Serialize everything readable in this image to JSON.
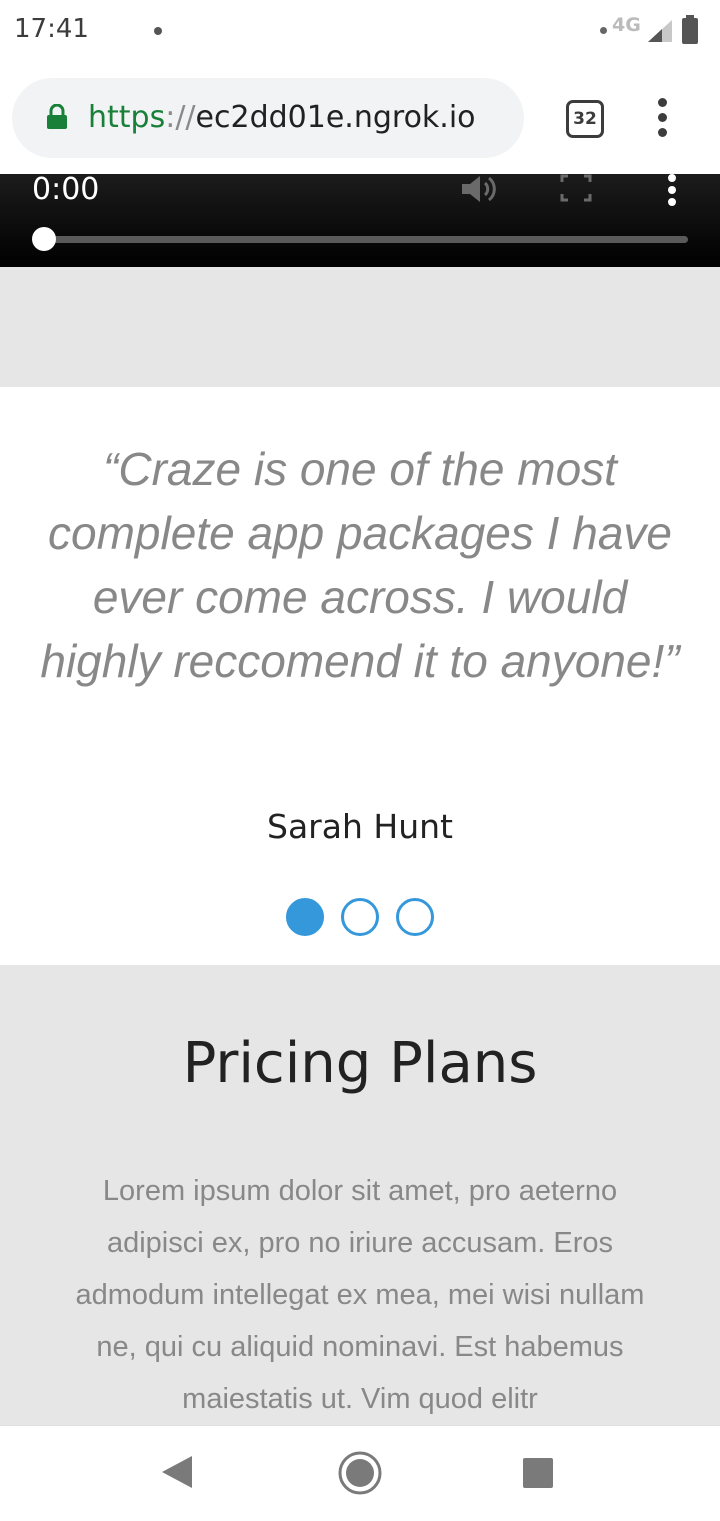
{
  "status_bar": {
    "time": "17:41",
    "network": "4G"
  },
  "browser": {
    "url_scheme": "https",
    "url_separator": "://",
    "url_host": "ec2dd01e.ngrok.io",
    "tab_count": "32"
  },
  "video": {
    "current_time": "0:00",
    "progress": 0
  },
  "testimonial": {
    "quote": "“Craze is one of the most complete app packages I have ever come across. I would highly reccomend it to anyone!”",
    "author": "Sarah Hunt",
    "slide_count": 3,
    "active_slide": 0
  },
  "pricing": {
    "title": "Pricing Plans",
    "text": "Lorem ipsum dolor sit amet, pro aeterno adipisci ex, pro no iriure accusam. Eros admodum intellegat ex mea, mei wisi nullam ne, qui cu aliquid nominavi. Est habemus maiestatis ut. Vim quod elitr"
  },
  "colors": {
    "accent": "#3498db",
    "secure_green": "#188038"
  }
}
